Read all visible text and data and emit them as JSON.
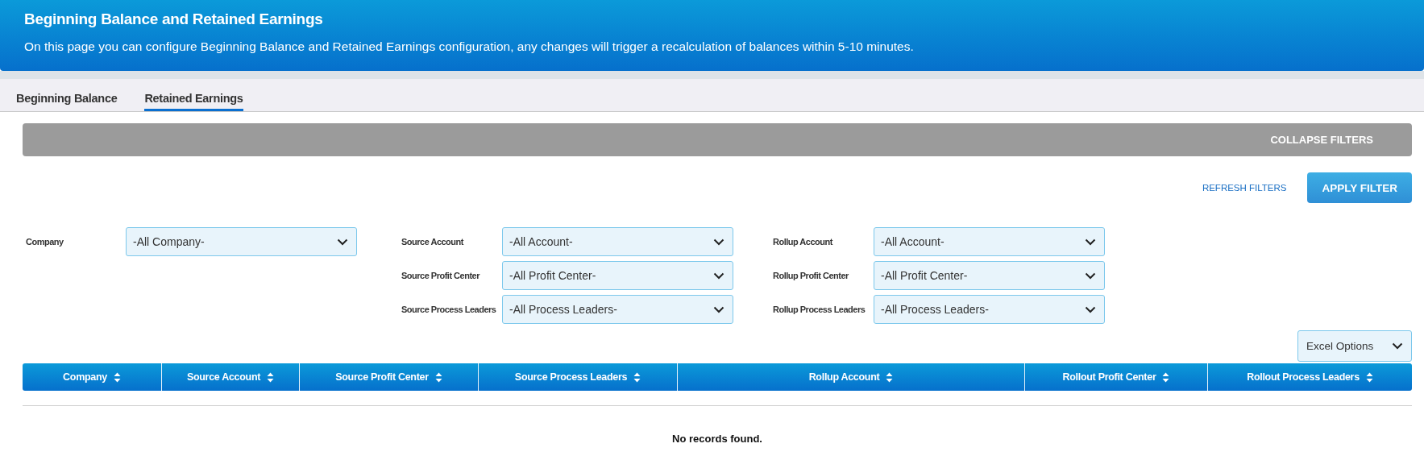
{
  "header": {
    "title": "Beginning Balance and Retained Earnings",
    "description": "On this page you can configure Beginning Balance and Retained Earnings configuration, any changes will trigger a recalculation of balances within 5-10 minutes."
  },
  "tabs": [
    {
      "label": "Beginning Balance",
      "selected": false
    },
    {
      "label": "Retained Earnings",
      "selected": true
    }
  ],
  "filter_bar": {
    "toggle": "COLLAPSE FILTERS"
  },
  "actions": {
    "refresh": "REFRESH FILTERS",
    "apply": "APPLY FILTER"
  },
  "filter_columns": [
    [
      {
        "label": "Company",
        "value": "-All Company-"
      }
    ],
    [
      {
        "label": "Source Account",
        "value": "-All Account-"
      },
      {
        "label": "Source Profit Center",
        "value": "-All Profit Center-"
      },
      {
        "label": "Source Process Leaders",
        "value": "-All Process Leaders-"
      }
    ],
    [
      {
        "label": "Rollup Account",
        "value": "-All Account-"
      },
      {
        "label": "Rollup Profit Center",
        "value": "-All Profit Center-"
      },
      {
        "label": "Rollup Process Leaders",
        "value": "-All Process Leaders-"
      }
    ]
  ],
  "excel_options": "Excel Options",
  "table": {
    "columns": [
      "Company",
      "Source Account",
      "Source Profit Center",
      "Source Process Leaders",
      "Rollup Account",
      "Rollout Profit Center",
      "Rollout Process Leaders"
    ],
    "empty_message": "No records found."
  }
}
